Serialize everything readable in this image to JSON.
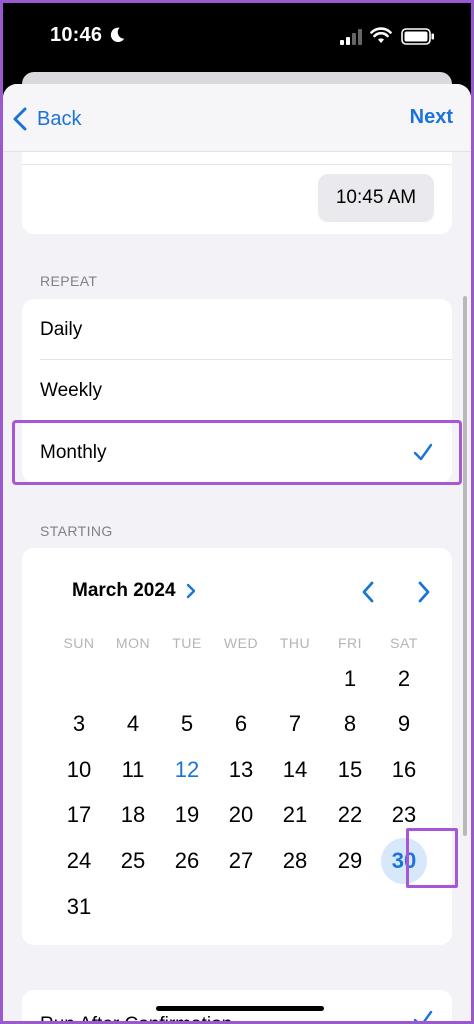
{
  "status_bar": {
    "time": "10:46"
  },
  "nav": {
    "back_label": "Back",
    "next_label": "Next"
  },
  "time_field": {
    "value": "10:45 AM"
  },
  "repeat": {
    "section_label": "REPEAT",
    "options": [
      {
        "label": "Daily",
        "selected": false
      },
      {
        "label": "Weekly",
        "selected": false
      },
      {
        "label": "Monthly",
        "selected": true
      }
    ]
  },
  "starting": {
    "section_label": "STARTING",
    "month_label": "March 2024",
    "weekdays": [
      "SUN",
      "MON",
      "TUE",
      "WED",
      "THU",
      "FRI",
      "SAT"
    ],
    "days": [
      "1",
      "2",
      "3",
      "4",
      "5",
      "6",
      "7",
      "8",
      "9",
      "10",
      "11",
      "12",
      "13",
      "14",
      "15",
      "16",
      "17",
      "18",
      "19",
      "20",
      "21",
      "22",
      "23",
      "24",
      "25",
      "26",
      "27",
      "28",
      "29",
      "30",
      "31"
    ],
    "today": "12",
    "selected": "30"
  },
  "run_after_confirmation": {
    "label": "Run After Confirmation",
    "checked": true
  },
  "colors": {
    "accent": "#1a73d9",
    "highlight_outline": "#a855d6",
    "selected_day_bg": "#d8e8fb"
  }
}
